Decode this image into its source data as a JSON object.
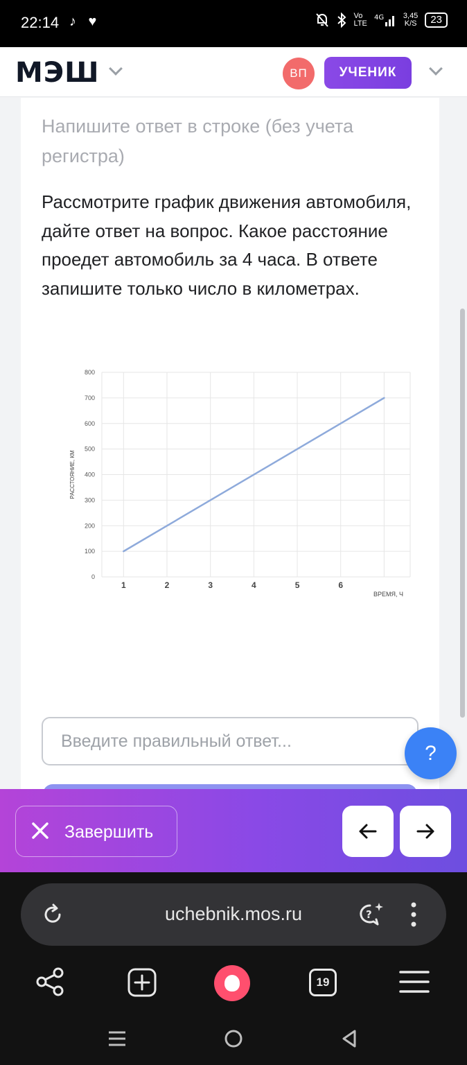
{
  "status_bar": {
    "time": "22:14",
    "battery": "23",
    "net_speed": "3,45",
    "net_unit": "K/S"
  },
  "header": {
    "logo": "МЭШ",
    "avatar_initials": "ВП",
    "role": "УЧЕНИК"
  },
  "task": {
    "hint": "Напишите ответ в строке (без учета регистра)",
    "question": "Рассмотрите график движения автомобиля, дайте ответ на вопрос. Какое расстояние проедет автомобиль за 4 часа. В ответе запишите только число в километрах."
  },
  "chart_data": {
    "type": "line",
    "title": "",
    "xlabel": "ВРЕМЯ, Ч",
    "ylabel": "РАССТОЯНИЕ, КМ",
    "x_ticks": [
      1,
      2,
      3,
      4,
      5,
      6
    ],
    "y_ticks": [
      0,
      100,
      200,
      300,
      400,
      500,
      600,
      700,
      800
    ],
    "xlim": [
      0.5,
      7.6
    ],
    "ylim": [
      0,
      800
    ],
    "grid": true,
    "series": [
      {
        "x": [
          1,
          7
        ],
        "y": [
          100,
          700
        ]
      }
    ],
    "line_color": "#8eaadb"
  },
  "answer": {
    "placeholder": "Введите правильный ответ..."
  },
  "help": {
    "label": "?"
  },
  "actions": {
    "finish_label": "Завершить"
  },
  "browser": {
    "url": "uchebnik.mos.ru",
    "tab_count": "19"
  }
}
